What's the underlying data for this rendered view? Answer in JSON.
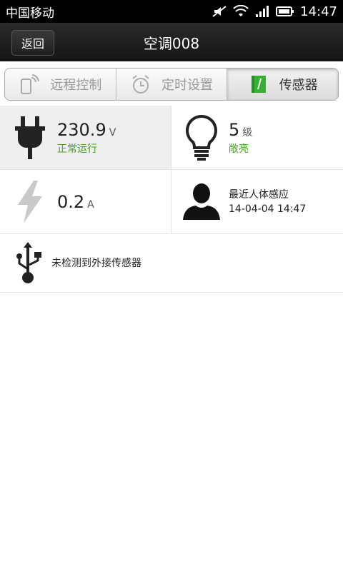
{
  "status_bar": {
    "carrier": "中国移动",
    "time": "14:47",
    "icons": [
      "mute-icon",
      "wifi-icon",
      "signal-icon",
      "battery-icon"
    ]
  },
  "title_bar": {
    "back_label": "返回",
    "title": "空调008"
  },
  "tabs": [
    {
      "label": "远程控制",
      "icon": "remote-phone-icon",
      "active": false
    },
    {
      "label": "定时设置",
      "icon": "alarm-clock-icon",
      "active": false
    },
    {
      "label": "传感器",
      "icon": "sensor-notebook-icon",
      "active": true
    }
  ],
  "sensors": {
    "voltage": {
      "value": "230.9",
      "unit": "V",
      "status": "正常运行",
      "icon": "plug-icon"
    },
    "light": {
      "value": "5",
      "unit": "级",
      "status": "敞亮",
      "icon": "lightbulb-icon"
    },
    "current": {
      "value": "0.2",
      "unit": "A",
      "icon": "lightning-icon"
    },
    "human": {
      "label": "最近人体感应",
      "timestamp": "14-04-04 14:47",
      "icon": "person-silhouette-icon"
    },
    "usb": {
      "label": "未检测到外接传感器",
      "icon": "usb-icon"
    }
  },
  "colors": {
    "status_green": "#46a11b",
    "title_bg": "#1b1b1b"
  }
}
